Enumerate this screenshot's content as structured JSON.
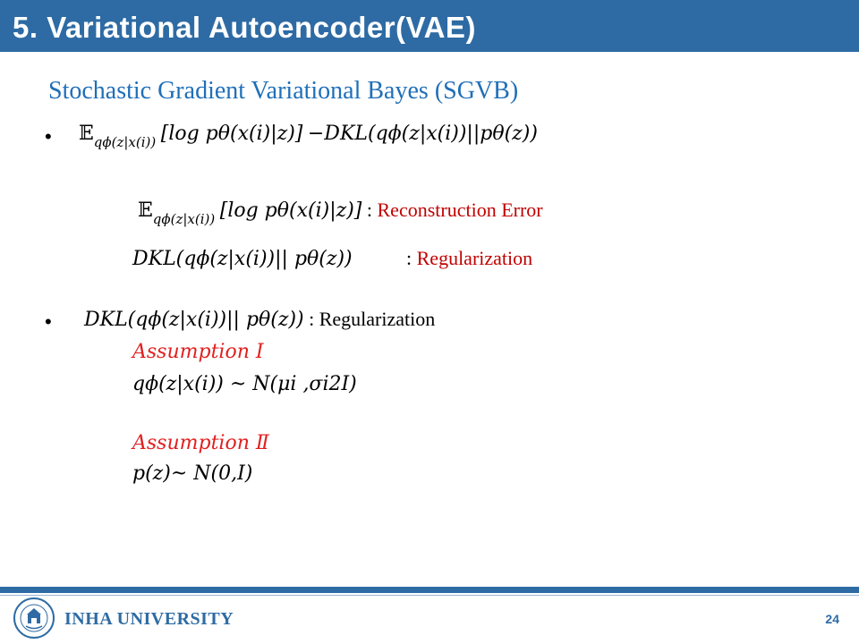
{
  "header": {
    "title": "5. Variational Autoencoder(VAE)"
  },
  "subtitle": "Stochastic Gradient Variational Bayes (SGVB)",
  "bullet1": {
    "expectation": "𝔼",
    "exp_subscript": "qϕ(z|x(i))",
    "log_term": "[log pθ(x(i)|z)]",
    "kl_term": "−DKL(qϕ(z|x(i))||pθ(z))"
  },
  "recon": {
    "expectation": "𝔼",
    "exp_subscript": "qϕ(z|x(i))",
    "log_term": "[log pθ(x(i)|z)]",
    "colon": ":",
    "label": "Reconstruction Error"
  },
  "reg": {
    "kl_term": "DKL(qϕ(z|x(i))|| pθ(z))",
    "colon": ":",
    "label": "Regularization"
  },
  "bullet2": {
    "kl_term": "DKL(qϕ(z|x(i))|| pθ(z))",
    "label": ": Regularization"
  },
  "assumption1": {
    "title": "Assumption Ⅰ",
    "formula": "qϕ(z|x(i)) ~ N(μi ,σi2I)"
  },
  "assumption2": {
    "title": "Assumption Ⅱ",
    "formula": "p(z)~ N(0,I)"
  },
  "footer": {
    "university": "INHA UNIVERSITY",
    "page_number": "24",
    "seal_text": "인하대학교 INHA UNIVERSITY 1954"
  },
  "colors": {
    "brand_blue": "#2e6ba4",
    "subtitle_blue": "#1f6fb8",
    "accent_red": "#c00000"
  }
}
